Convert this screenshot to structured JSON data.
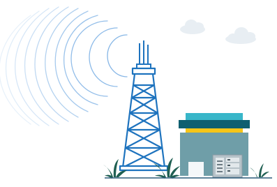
{
  "scene": {
    "description_icons": [
      "signal-waves-icon",
      "antenna-icon",
      "transmission-tower-icon",
      "cloud-icon",
      "building-icon",
      "server-rack-icon",
      "plant-icon"
    ],
    "colors": {
      "background": "#ffffff",
      "tower_blue": "#1e73be",
      "wave_blue": "#7fb2e5",
      "cloud_grey": "#e8eef3",
      "building_body": "#6f9ea8",
      "roof_teal": "#38b6c9",
      "roof_band_dark": "#0f5f70",
      "roof_band_yellow": "#f5c518",
      "door_white": "#f4f7f9",
      "rack_grey": "#b7c3c9",
      "plant_dark": "#1f5f52",
      "ground_line": "#2c5b7a"
    }
  }
}
